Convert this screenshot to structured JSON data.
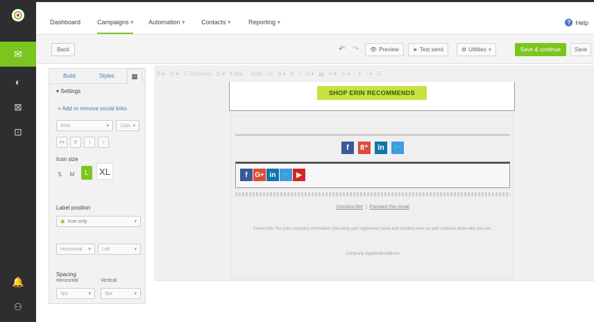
{
  "nav": {
    "items": [
      "Dashboard",
      "Campaigns",
      "Automation",
      "Contacts",
      "Reporting"
    ],
    "dropdown_caret": "▾",
    "help": "Help"
  },
  "toolbar": {
    "back": "Back",
    "preview": "Preview",
    "test_send": "Test send",
    "utilities": "Utilities",
    "save_continue": "Save & continue",
    "save": "Save"
  },
  "panel": {
    "tabs": [
      "Build",
      "Styles"
    ],
    "settings": "Settings",
    "add_social": "Add or remove social links",
    "font_select": "Arial",
    "font_size": "12px",
    "format_buttons": [
      "A",
      "B",
      "I",
      "I"
    ],
    "icon_size_label": "Icon size",
    "sizes": [
      "S",
      "M",
      "L",
      "XL"
    ],
    "label_position_label": "Label position",
    "label_position_value": "Icon only",
    "orientation": "Horizontal",
    "align": "Left",
    "spacing_label": "Spacing",
    "horizontal_label": "Horizontal",
    "vertical_label": "Vertical",
    "horizontal_value": "3px",
    "vertical_value": "3px"
  },
  "canvas": {
    "format_toolbar": [
      "B ▾",
      "✎ ▾",
      "☷ Dynamic",
      "Ω ▾",
      "¶ Bre..",
      "Arial",
      "12",
      "A ▾",
      "B",
      "I",
      "U ▾",
      "▤",
      "≡ ▾",
      "≣ ▾",
      "⁞ ▾",
      "⁝ ▾",
      "☰"
    ],
    "shop_button": "SHOP ERIN RECOMMENDS",
    "footer_unsubscribe": "Unsubscribe",
    "footer_forward": "Forward this email",
    "footer_separator": "|",
    "footer_text": "Footer info. Put your company information (including your registered name and number) here as your contacts know who you are.",
    "footer_address": "Company registered address"
  },
  "colors": {
    "accent": "#7cc520",
    "rail": "#2e2e30",
    "link": "#4a78c2",
    "shop_button_bg": "#c8e240"
  },
  "icons": [
    "mail-icon",
    "contrast-icon",
    "calendar-x-icon",
    "form-icon",
    "bell-icon",
    "users-icon",
    "undo-icon",
    "redo-icon",
    "eye-icon",
    "paper-plane-icon",
    "gear-icon",
    "facebook-icon",
    "google-plus-icon",
    "linkedin-icon",
    "twitter-icon",
    "youtube-icon"
  ]
}
